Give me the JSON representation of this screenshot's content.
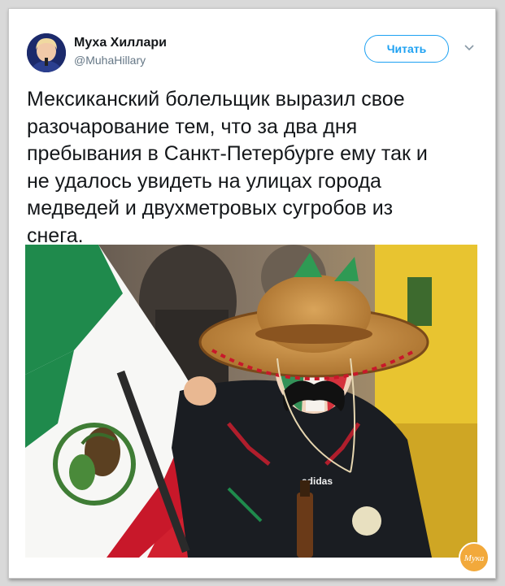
{
  "author": {
    "name": "Муха Хиллари",
    "handle": "@MuhaHillary"
  },
  "follow_button": "Читать",
  "icons": {
    "avatar": "avatar",
    "menu": "chevron-down-icon",
    "watermark": "logo"
  },
  "tweet": {
    "lines": [
      "Мексиканский болельщик выразил свое",
      "разочарование тем, что за два дня",
      "пребывания в Санкт-Петербурге ему так и",
      "не удалось увидеть на улицах города",
      "медведей и двухметровых сугробов из",
      "снега."
    ]
  },
  "photo": {
    "jersey_brand": "adidas"
  },
  "watermark": {
    "text": "Мука"
  },
  "colors": {
    "follow_accent": "#1da1f2",
    "text": "#14171a",
    "handle": "#657786",
    "flag_green": "#1f8a4c",
    "flag_red": "#d1202f"
  }
}
